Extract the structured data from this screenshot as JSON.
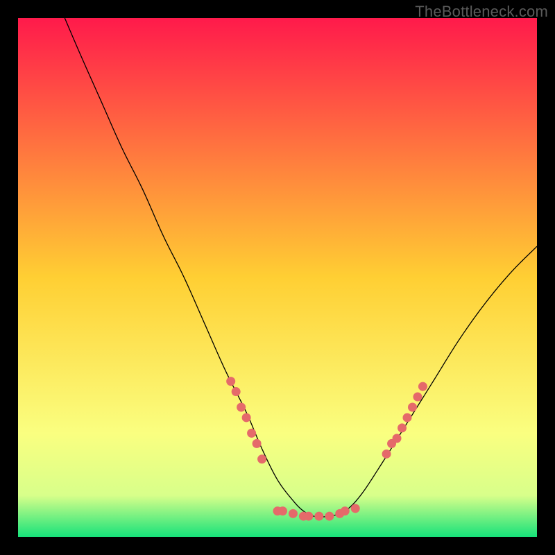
{
  "watermark": "TheBottleneck.com",
  "chart_data": {
    "type": "line",
    "title": "",
    "xlabel": "",
    "ylabel": "",
    "xlim": [
      0,
      100
    ],
    "ylim": [
      0,
      100
    ],
    "grid": false,
    "legend": false,
    "background_gradient": {
      "stops": [
        {
          "pct": 0,
          "color": "#ff1a4b"
        },
        {
          "pct": 50,
          "color": "#ffcf33"
        },
        {
          "pct": 80,
          "color": "#faff80"
        },
        {
          "pct": 92,
          "color": "#d8ff8a"
        },
        {
          "pct": 100,
          "color": "#16e27a"
        }
      ]
    },
    "series": [
      {
        "name": "curve",
        "x": [
          9,
          12,
          16,
          20,
          24,
          28,
          32,
          36,
          40,
          44,
          47,
          50,
          53,
          55,
          57,
          60,
          63,
          66,
          70,
          75,
          80,
          85,
          90,
          95,
          100
        ],
        "y": [
          100,
          93,
          84,
          75,
          67,
          58,
          50,
          41,
          32,
          24,
          17,
          11,
          7,
          5,
          4,
          4,
          5,
          8,
          14,
          22,
          30,
          38,
          45,
          51,
          56
        ],
        "stroke": "#000000",
        "width": 1.3
      }
    ],
    "highlight_dots": {
      "color": "#e56a6a",
      "radius": 6.5,
      "points": [
        {
          "x": 41,
          "y": 30
        },
        {
          "x": 42,
          "y": 28
        },
        {
          "x": 43,
          "y": 25
        },
        {
          "x": 44,
          "y": 23
        },
        {
          "x": 45,
          "y": 20
        },
        {
          "x": 46,
          "y": 18
        },
        {
          "x": 47,
          "y": 15
        },
        {
          "x": 50,
          "y": 5
        },
        {
          "x": 51,
          "y": 5
        },
        {
          "x": 53,
          "y": 4.5
        },
        {
          "x": 55,
          "y": 4
        },
        {
          "x": 56,
          "y": 4
        },
        {
          "x": 58,
          "y": 4
        },
        {
          "x": 60,
          "y": 4
        },
        {
          "x": 62,
          "y": 4.5
        },
        {
          "x": 63,
          "y": 5
        },
        {
          "x": 65,
          "y": 5.5
        },
        {
          "x": 71,
          "y": 16
        },
        {
          "x": 72,
          "y": 18
        },
        {
          "x": 73,
          "y": 19
        },
        {
          "x": 74,
          "y": 21
        },
        {
          "x": 75,
          "y": 23
        },
        {
          "x": 76,
          "y": 25
        },
        {
          "x": 77,
          "y": 27
        },
        {
          "x": 78,
          "y": 29
        }
      ]
    }
  }
}
